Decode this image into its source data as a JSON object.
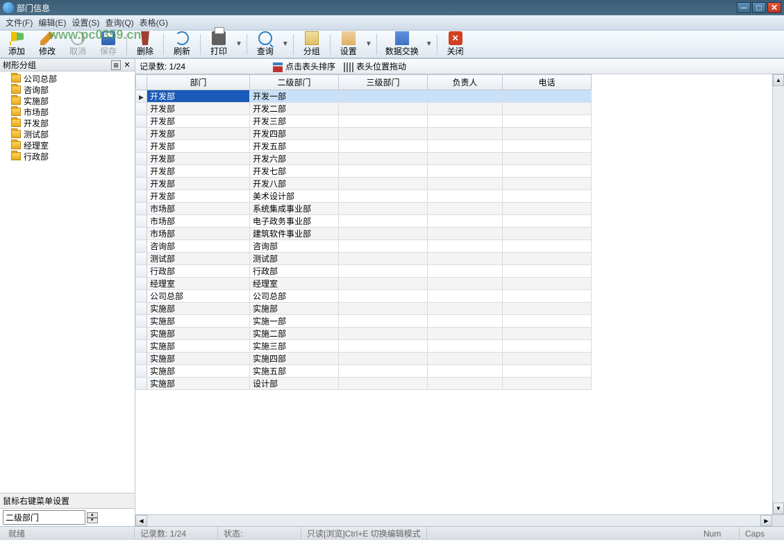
{
  "window": {
    "title": "部门信息"
  },
  "watermark": "www.pc0359.cn",
  "menu": {
    "file": "文件(F)",
    "edit": "编辑(E)",
    "settings": "设置(S)",
    "query": "查询(Q)",
    "table": "表格(G)"
  },
  "toolbar": {
    "add": "添加",
    "modify": "修改",
    "cancel": "取消",
    "save": "保存",
    "delete": "删除",
    "refresh": "刷新",
    "print": "打印",
    "query": "查询",
    "group": "分组",
    "settings": "设置",
    "exchange": "数据交换",
    "close": "关闭"
  },
  "sidebar": {
    "title": "树形分组",
    "items": [
      "公司总部",
      "咨询部",
      "实施部",
      "市场部",
      "开发部",
      "测试部",
      "经理室",
      "行政部"
    ],
    "footer_hint": "鼠标右键菜单设置",
    "combo_value": "二级部门"
  },
  "records": {
    "label": "记录数: 1/24",
    "sort_hint": "点击表头排序",
    "drag_hint": "表头位置拖动"
  },
  "grid": {
    "columns": [
      "部门",
      "二级部门",
      "三级部门",
      "负责人",
      "电话"
    ],
    "rows": [
      {
        "dept": "开发部",
        "sub": "开发一部"
      },
      {
        "dept": "开发部",
        "sub": "开发二部"
      },
      {
        "dept": "开发部",
        "sub": "开发三部"
      },
      {
        "dept": "开发部",
        "sub": "开发四部"
      },
      {
        "dept": "开发部",
        "sub": "开发五部"
      },
      {
        "dept": "开发部",
        "sub": "开发六部"
      },
      {
        "dept": "开发部",
        "sub": "开发七部"
      },
      {
        "dept": "开发部",
        "sub": "开发八部"
      },
      {
        "dept": "开发部",
        "sub": "美术设计部"
      },
      {
        "dept": "市场部",
        "sub": "系统集成事业部"
      },
      {
        "dept": "市场部",
        "sub": "电子政务事业部"
      },
      {
        "dept": "市场部",
        "sub": "建筑软件事业部"
      },
      {
        "dept": "咨询部",
        "sub": "咨询部"
      },
      {
        "dept": "测试部",
        "sub": "测试部"
      },
      {
        "dept": "行政部",
        "sub": "行政部"
      },
      {
        "dept": "经理室",
        "sub": "经理室"
      },
      {
        "dept": "公司总部",
        "sub": "公司总部"
      },
      {
        "dept": "实施部",
        "sub": "实施部"
      },
      {
        "dept": "实施部",
        "sub": "实施一部"
      },
      {
        "dept": "实施部",
        "sub": "实施二部"
      },
      {
        "dept": "实施部",
        "sub": "实施三部"
      },
      {
        "dept": "实施部",
        "sub": "实施四部"
      },
      {
        "dept": "实施部",
        "sub": "实施五部"
      },
      {
        "dept": "实施部",
        "sub": "设计部"
      }
    ]
  },
  "status": {
    "ready": "就绪",
    "records_label": "记录数:",
    "records_value": "1/24",
    "state_label": "状态:",
    "state_value": "只读[浏览]Ctrl+E 切换编辑模式",
    "num": "Num",
    "caps": "Caps"
  }
}
